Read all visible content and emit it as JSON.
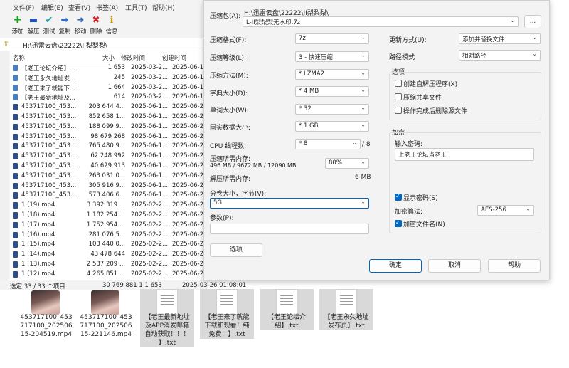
{
  "file_manager": {
    "menu": [
      "文件(F)",
      "编辑(E)",
      "查看(V)",
      "书签(A)",
      "工具(T)",
      "帮助(H)"
    ],
    "toolbar": [
      {
        "label": "添加",
        "icon": "add-icon",
        "color": "#22a022"
      },
      {
        "label": "解压",
        "icon": "extract-icon",
        "color": "#2050c0"
      },
      {
        "label": "测试",
        "icon": "test-icon",
        "color": "#1aa0b0"
      },
      {
        "label": "复制",
        "icon": "copy-icon",
        "color": "#2a6ad0"
      },
      {
        "label": "移动",
        "icon": "move-icon",
        "color": "#2a6ad0"
      },
      {
        "label": "删除",
        "icon": "delete-icon",
        "color": "#d02020"
      },
      {
        "label": "信息",
        "icon": "info-icon",
        "color": "#c89a00"
      }
    ],
    "path": "H:\\迅雷云盘\\22222\\II梨梨梨\\",
    "columns": [
      "名称",
      "大小",
      "修改时间",
      "创建时间"
    ],
    "files": [
      {
        "name": "【老王论坛介绍】...",
        "size": "1 653",
        "modified": "2025-03-2...",
        "created": "2025-06-1...",
        "type": "txt"
      },
      {
        "name": "【老王永久地址发...",
        "size": "245",
        "modified": "2025-03-2...",
        "created": "2025-06-1...",
        "type": "txt"
      },
      {
        "name": "【老王来了就能下...",
        "size": "1 664",
        "modified": "2025-03-2...",
        "created": "2025-06-1...",
        "type": "txt"
      },
      {
        "name": "【老王最新地址及...",
        "size": "614",
        "modified": "2025-03-2...",
        "created": "2025-06-1...",
        "type": "txt"
      },
      {
        "name": "453717100_453...",
        "size": "203 644 4...",
        "modified": "2025-06-1...",
        "created": "2025-06-2...",
        "type": "mp4"
      },
      {
        "name": "453717100_453...",
        "size": "852 658 1...",
        "modified": "2025-06-1...",
        "created": "2025-06-2...",
        "type": "mp4"
      },
      {
        "name": "453717100_453...",
        "size": "188 099 9...",
        "modified": "2025-06-1...",
        "created": "2025-06-2...",
        "type": "mp4"
      },
      {
        "name": "453717100_453...",
        "size": "98 679 268",
        "modified": "2025-06-1...",
        "created": "2025-06-2...",
        "type": "mp4"
      },
      {
        "name": "453717100_453...",
        "size": "765 480 9...",
        "modified": "2025-06-1...",
        "created": "2025-06-2...",
        "type": "mp4"
      },
      {
        "name": "453717100_453...",
        "size": "62 248 992",
        "modified": "2025-06-1...",
        "created": "2025-06-2...",
        "type": "mp4"
      },
      {
        "name": "453717100_453...",
        "size": "40 629 913",
        "modified": "2025-06-1...",
        "created": "2025-06-2...",
        "type": "mp4"
      },
      {
        "name": "453717100_453...",
        "size": "263 031 0...",
        "modified": "2025-06-1...",
        "created": "2025-06-2...",
        "type": "mp4"
      },
      {
        "name": "453717100_453...",
        "size": "305 916 9...",
        "modified": "2025-06-1...",
        "created": "2025-06-2...",
        "type": "mp4"
      },
      {
        "name": "453717100_453...",
        "size": "573 406 6...",
        "modified": "2025-06-1...",
        "created": "2025-06-2...",
        "type": "mp4"
      },
      {
        "name": "1 (19).mp4",
        "size": "3 392 319 ...",
        "modified": "2025-02-2...",
        "created": "2025-06-2...",
        "type": "mp4"
      },
      {
        "name": "1 (18).mp4",
        "size": "1 182 254 ...",
        "modified": "2025-02-2...",
        "created": "2025-06-2...",
        "type": "mp4"
      },
      {
        "name": "1 (17).mp4",
        "size": "1 752 954 ...",
        "modified": "2025-02-2...",
        "created": "2025-06-2...",
        "type": "mp4"
      },
      {
        "name": "1 (16).mp4",
        "size": "281 076 5...",
        "modified": "2025-02-2...",
        "created": "2025-06-2...",
        "type": "mp4"
      },
      {
        "name": "1 (15).mp4",
        "size": "103 440 0...",
        "modified": "2025-02-2...",
        "created": "2025-06-2...",
        "type": "mp4"
      },
      {
        "name": "1 (14).mp4",
        "size": "43 478 644",
        "modified": "2025-02-2...",
        "created": "2025-06-2...",
        "type": "mp4"
      },
      {
        "name": "1 (13).mp4",
        "size": "2 537 209 ...",
        "modified": "2025-02-2...",
        "created": "2025-06-2...",
        "type": "mp4"
      },
      {
        "name": "1 (12).mp4",
        "size": "4 265 851 ...",
        "modified": "2025-02-2...",
        "created": "2025-06-2...",
        "type": "mp4"
      }
    ],
    "status": {
      "selection": "选定 33 / 33 个项目",
      "size": "30 769 881 1 1 653",
      "date": "2025-03-26 01:08:01"
    }
  },
  "dialog": {
    "archive_label": "压缩包(A):",
    "archive_dir": "H:\\迅雷云盘\\22222\\II梨梨梨\\",
    "archive_name": "L-II梨梨梨无水印.7z",
    "browse_label": "...",
    "left_fields": [
      {
        "label": "压缩格式(F):",
        "value": "7z"
      },
      {
        "label": "压缩等级(L):",
        "value": "3 - 快速压缩"
      },
      {
        "label": "压缩方法(M):",
        "value": "* LZMA2"
      },
      {
        "label": "字典大小(D):",
        "value": "* 4 MB"
      },
      {
        "label": "单词大小(W):",
        "value": "* 32"
      },
      {
        "label": "固实数据大小:",
        "value": "* 1 GB"
      },
      {
        "label": "CPU 线程数:",
        "value": "* 8"
      }
    ],
    "cpu_threads_max": "/ 8",
    "memory_compress_label": "压缩所需内存:",
    "memory_compress_value": "496 MB / 9672 MB / 12090 MB",
    "memory_percent": "80%",
    "memory_decompress_label": "解压所需内存:",
    "memory_decompress_value": "6 MB",
    "split_label": "分卷大小，字节(V):",
    "split_value": "5G",
    "params_label": "参数(P):",
    "params_value": "",
    "options_button": "选项",
    "update_label": "更新方式(U):",
    "update_value": "添加并替换文件",
    "path_mode_label": "路径模式",
    "path_mode_value": "相对路径",
    "options_group": "选项",
    "options": [
      {
        "label": "创建自解压程序(X)",
        "checked": false
      },
      {
        "label": "压缩共享文件",
        "checked": false
      },
      {
        "label": "操作完成后删除源文件",
        "checked": false
      }
    ],
    "encryption_group": "加密",
    "password_label": "输入密码:",
    "password_value": "上老王论坛当老王",
    "show_password": {
      "label": "显示密码(S)",
      "checked": true
    },
    "enc_method_label": "加密算法:",
    "enc_method_value": "AES-256",
    "encrypt_names": {
      "label": "加密文件名(N)",
      "checked": true
    },
    "ok": "确定",
    "cancel": "取消",
    "help": "帮助"
  },
  "desktop": {
    "items": [
      {
        "caption": "453717100_453717100_20250615-204519.mp4",
        "lines": [
          "453717100_453",
          "717100_202506",
          "15-204519.mp4"
        ],
        "kind": "video"
      },
      {
        "caption": "453717100_453717100_20250615-221146.mp4",
        "lines": [
          "453717100_453",
          "717100_202506",
          "15-221146.mp4"
        ],
        "kind": "video"
      },
      {
        "caption": "【老王最新地址及APP消发邮箱自动获取！！！】.txt",
        "lines": [
          "【老王最新地址",
          "及APP消发邮箱",
          "自动获取！！！",
          "】.txt"
        ],
        "kind": "txt"
      },
      {
        "caption": "【老王来了就能下载和观看！纯免费！】.txt",
        "lines": [
          "【老王来了就能",
          "下载和观看！纯",
          "免费！】.txt"
        ],
        "kind": "txt"
      },
      {
        "caption": "【老王论坛介绍】.txt",
        "lines": [
          "【老王论坛介",
          "绍】.txt"
        ],
        "kind": "txt"
      },
      {
        "caption": "【老王永久地址发布页】.txt",
        "lines": [
          "【老王永久地址",
          "发布页】.txt"
        ],
        "kind": "txt"
      }
    ]
  }
}
